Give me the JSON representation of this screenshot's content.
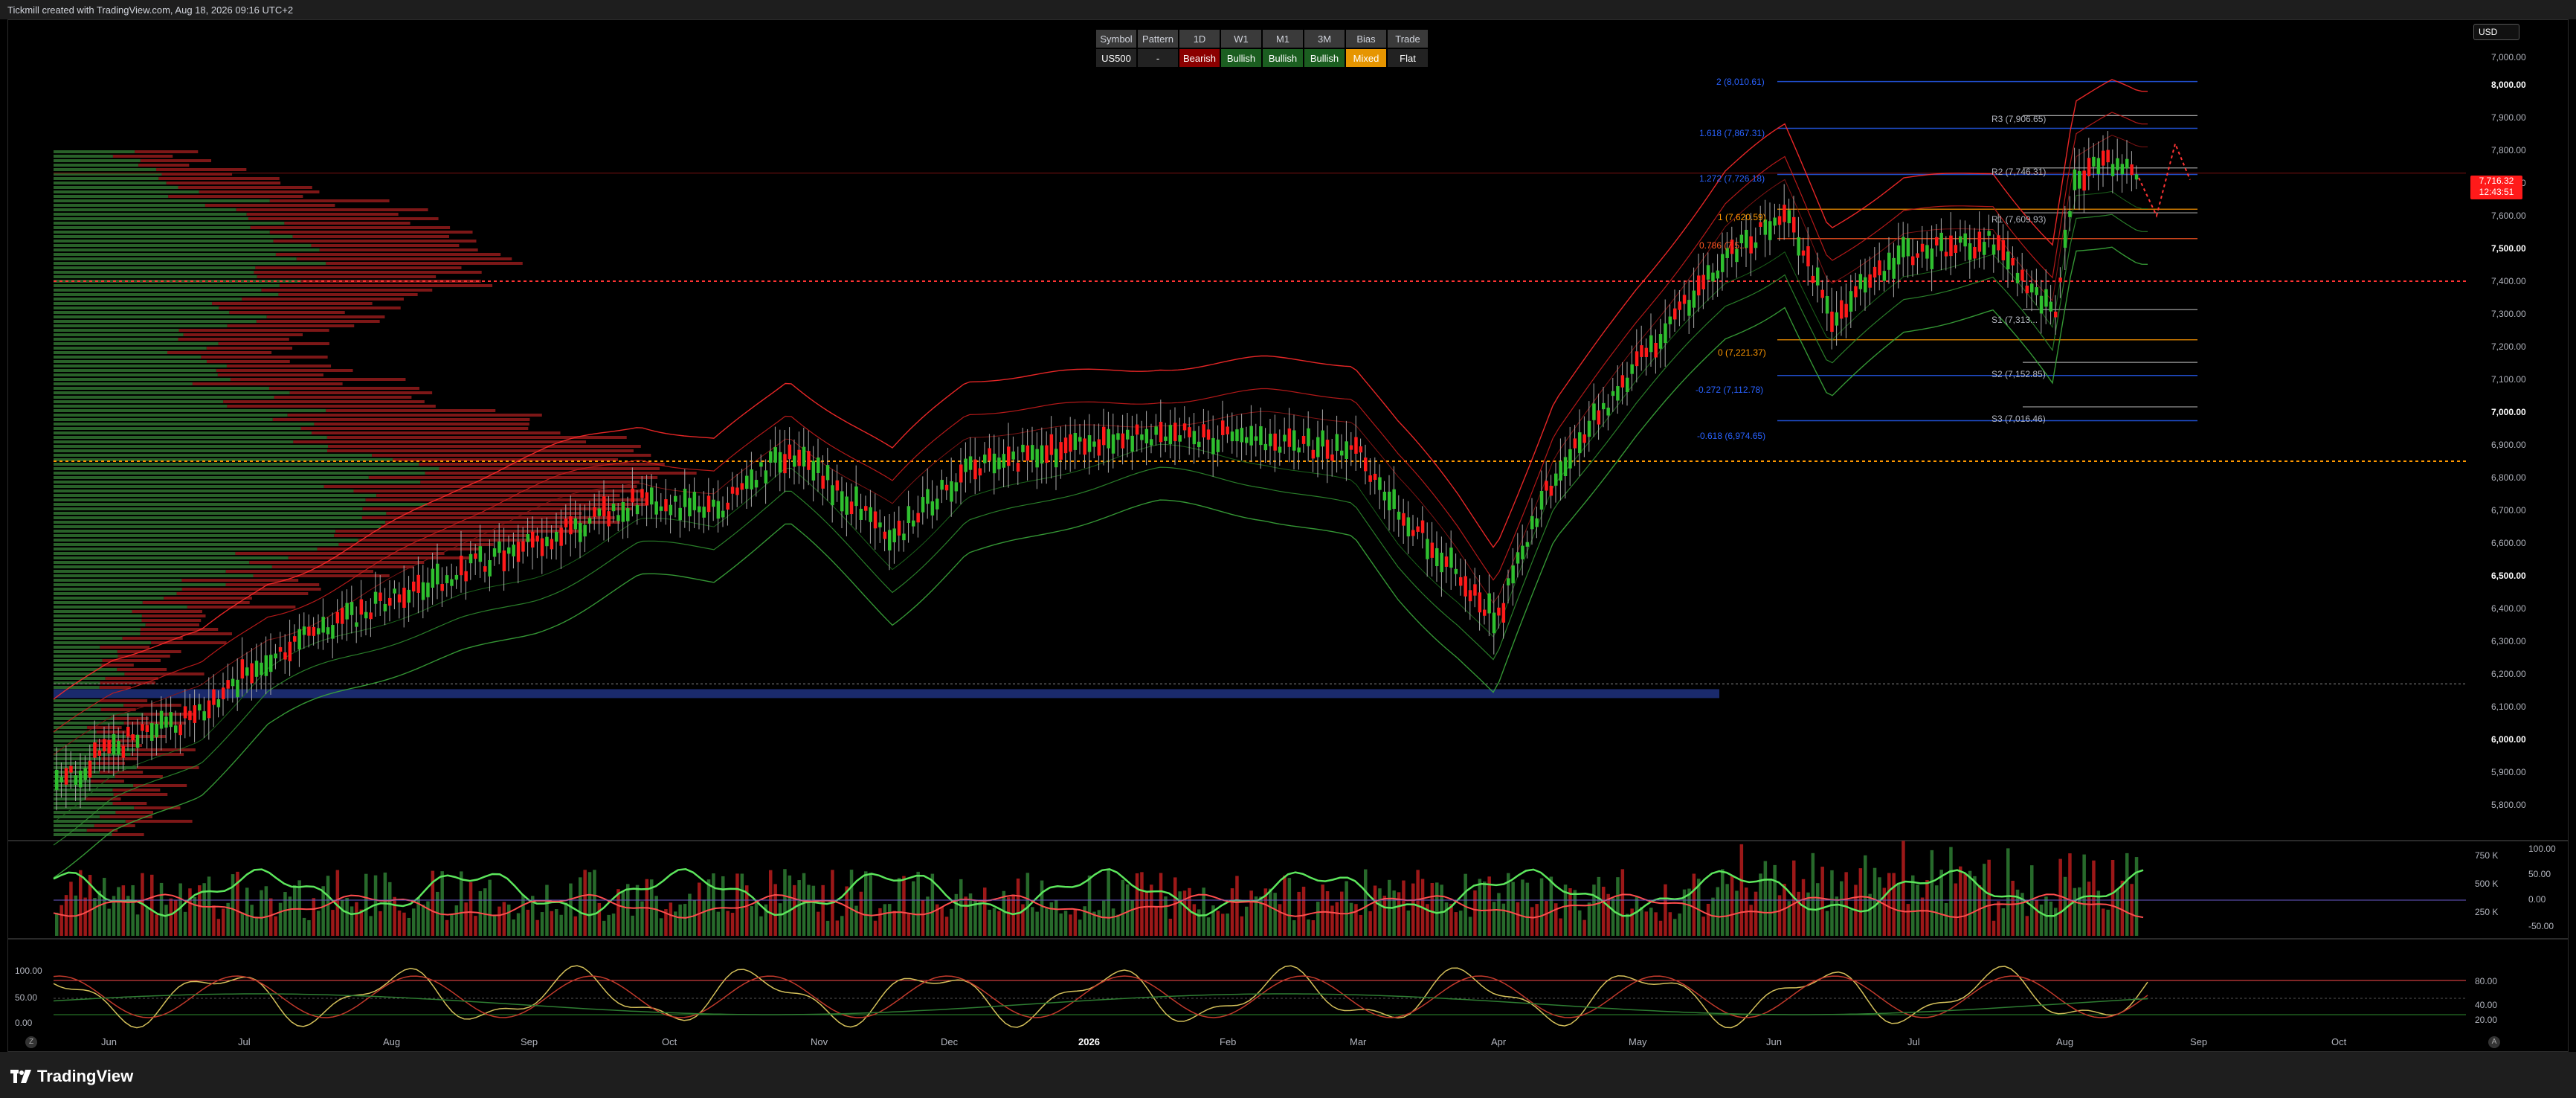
{
  "header": {
    "caption": "Tickmill created with TradingView.com, Aug 18, 2026 09:16 UTC+2"
  },
  "currency": "USD",
  "bias_table": {
    "headers": [
      "Symbol",
      "Pattern",
      "1D",
      "W1",
      "M1",
      "3M",
      "Bias",
      "Trade"
    ],
    "values": [
      "US500",
      "-",
      "Bearish",
      "Bullish",
      "Bullish",
      "Bullish",
      "Mixed",
      "Flat"
    ]
  },
  "current_price": {
    "price": "7,716.32",
    "countdown": "12:43:51"
  },
  "price_axis": [
    {
      "label": "8,000.00",
      "bold": true
    },
    {
      "label": "7,900.00",
      "bold": false
    },
    {
      "label": "7,800.00",
      "bold": false
    },
    {
      "label": "7,700.00",
      "bold": false
    },
    {
      "label": "7,600.00",
      "bold": false
    },
    {
      "label": "7,500.00",
      "bold": true
    },
    {
      "label": "7,400.00",
      "bold": false
    },
    {
      "label": "7,300.00",
      "bold": false
    },
    {
      "label": "7,200.00",
      "bold": false
    },
    {
      "label": "7,100.00",
      "bold": false
    },
    {
      "label": "7,000.00",
      "bold": true
    },
    {
      "label": "6,900.00",
      "bold": false
    },
    {
      "label": "6,800.00",
      "bold": false
    },
    {
      "label": "6,700.00",
      "bold": false
    },
    {
      "label": "6,600.00",
      "bold": false
    },
    {
      "label": "6,500.00",
      "bold": true
    },
    {
      "label": "6,400.00",
      "bold": false
    },
    {
      "label": "6,300.00",
      "bold": false
    },
    {
      "label": "6,200.00",
      "bold": false
    },
    {
      "label": "6,100.00",
      "bold": false
    },
    {
      "label": "6,000.00",
      "bold": true
    },
    {
      "label": "5,900.00",
      "bold": false
    },
    {
      "label": "5,800.00",
      "bold": false
    }
  ],
  "top_axis_value": "7,000.00",
  "time_axis": [
    {
      "label": "Jun",
      "bold": false
    },
    {
      "label": "Jul",
      "bold": false
    },
    {
      "label": "Aug",
      "bold": false
    },
    {
      "label": "Sep",
      "bold": false
    },
    {
      "label": "Oct",
      "bold": false
    },
    {
      "label": "Nov",
      "bold": false
    },
    {
      "label": "Dec",
      "bold": false
    },
    {
      "label": "2026",
      "bold": true
    },
    {
      "label": "Feb",
      "bold": false
    },
    {
      "label": "Mar",
      "bold": false
    },
    {
      "label": "Apr",
      "bold": false
    },
    {
      "label": "May",
      "bold": false
    },
    {
      "label": "Jun",
      "bold": false
    },
    {
      "label": "Jul",
      "bold": false
    },
    {
      "label": "Aug",
      "bold": false
    },
    {
      "label": "Sep",
      "bold": false
    },
    {
      "label": "Oct",
      "bold": false
    }
  ],
  "fib_levels": [
    {
      "label": "2 (8,010.61)",
      "color": "#2962ff"
    },
    {
      "label": "1.618 (7,867.31)",
      "color": "#2962ff"
    },
    {
      "label": "1.272 (7,726.18)",
      "color": "#2962ff"
    },
    {
      "label": "1 (7,620.59)",
      "color": "#ff9800"
    },
    {
      "label": "0.786 (7,5...",
      "color": "#ff5722"
    },
    {
      "label": "0 (7,221.37)",
      "color": "#ff9800"
    },
    {
      "label": "-0.272 (7,112.78)",
      "color": "#2962ff"
    },
    {
      "label": "-0.618 (6,974.65)",
      "color": "#2962ff"
    }
  ],
  "pivot_levels": [
    "R3 (7,906.65)",
    "R2 (7,746.31)",
    "R1 (7,609.93)",
    "S1 (7,313...",
    "S2 (7,152.85)",
    "S3 (7,016.46)"
  ],
  "volume_axis": [
    "750 K",
    "500 K",
    "250 K"
  ],
  "oscillator_axis": [
    "100.00",
    "50.00",
    "0.00",
    "-50.00"
  ],
  "stoch_axis_left": [
    "100.00",
    "50.00",
    "0.00"
  ],
  "stoch_axis_right": [
    "80.00",
    "40.00",
    "20.00"
  ],
  "footer": {
    "brand": "TradingView",
    "left_btn": "Z",
    "right_btn": "A"
  },
  "colors": {
    "bull": "#26a69a",
    "bear": "#ff1a1a",
    "bg": "#000000",
    "panel": "#1e1e1e"
  }
}
